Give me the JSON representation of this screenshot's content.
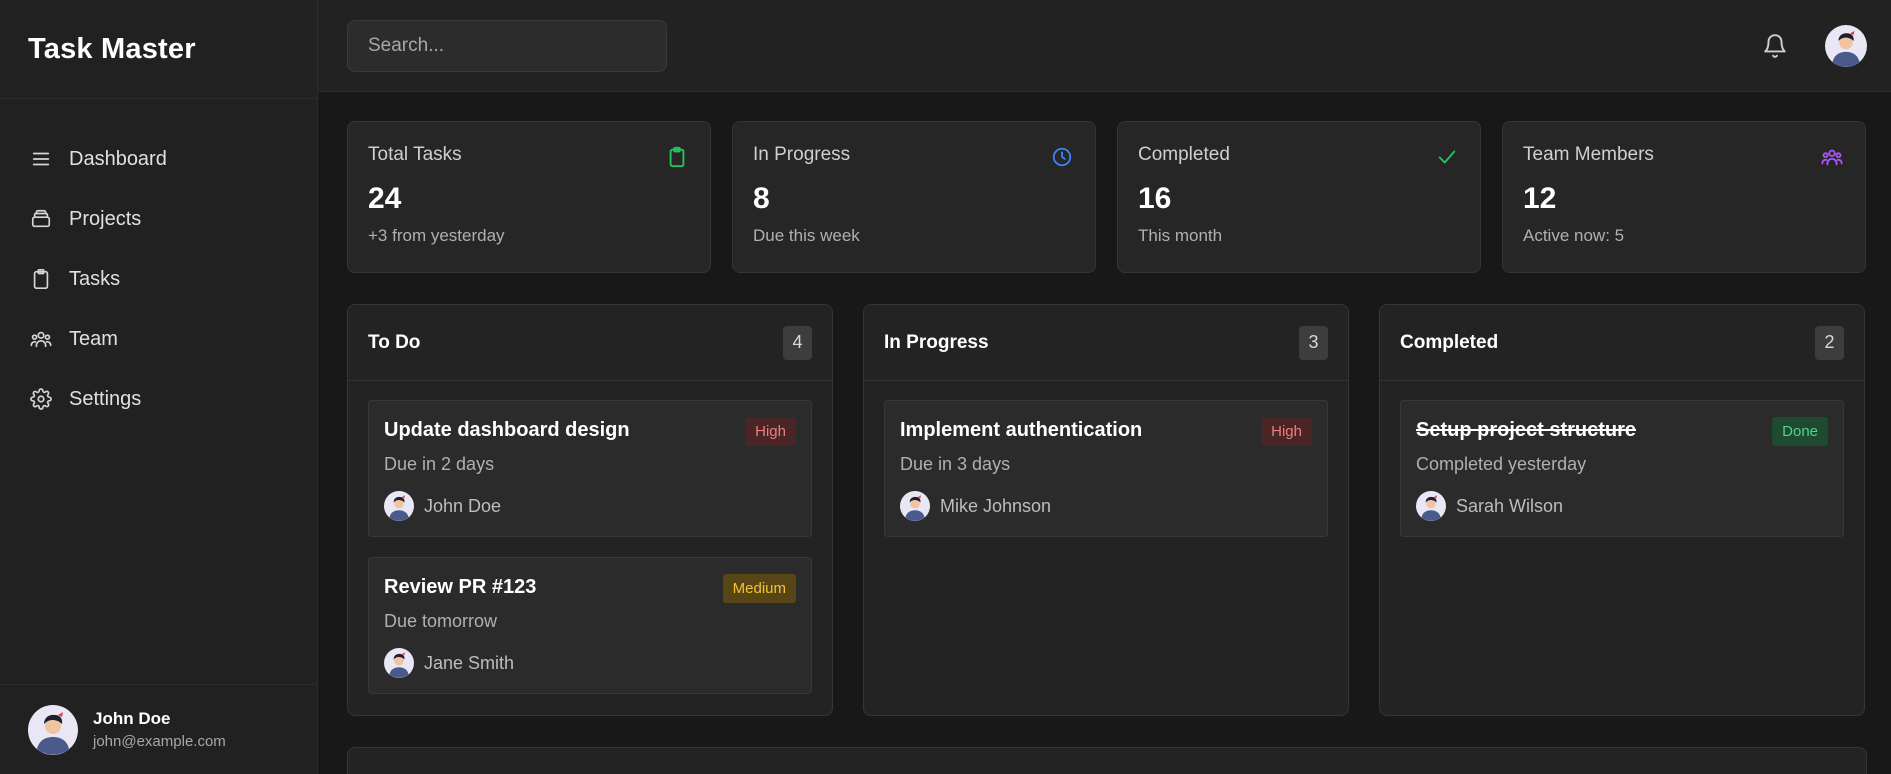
{
  "app": {
    "title": "Task Master"
  },
  "sidebar": {
    "items": [
      {
        "label": "Dashboard",
        "icon": "menu-icon"
      },
      {
        "label": "Projects",
        "icon": "layers-icon"
      },
      {
        "label": "Tasks",
        "icon": "clipboard-icon"
      },
      {
        "label": "Team",
        "icon": "users-icon"
      },
      {
        "label": "Settings",
        "icon": "gear-icon"
      }
    ],
    "user": {
      "name": "John Doe",
      "email": "john@example.com"
    }
  },
  "header": {
    "search_placeholder": "Search...",
    "search_value": ""
  },
  "stats": [
    {
      "label": "Total Tasks",
      "value": "24",
      "sub": "+3 from yesterday",
      "icon": "clipboard-icon",
      "color": "#22c55e"
    },
    {
      "label": "In Progress",
      "value": "8",
      "sub": "Due this week",
      "icon": "clock-icon",
      "color": "#3b82f6"
    },
    {
      "label": "Completed",
      "value": "16",
      "sub": "This month",
      "icon": "check-icon",
      "color": "#22c55e"
    },
    {
      "label": "Team Members",
      "value": "12",
      "sub": "Active now: 5",
      "icon": "users-icon",
      "color": "#a855f7"
    }
  ],
  "board": {
    "columns": [
      {
        "title": "To Do",
        "count": "4",
        "tasks": [
          {
            "title": "Update dashboard design",
            "due": "Due in 2 days",
            "assignee": "John Doe",
            "priority": "High",
            "priority_class": "high",
            "done": false
          },
          {
            "title": "Review PR #123",
            "due": "Due tomorrow",
            "assignee": "Jane Smith",
            "priority": "Medium",
            "priority_class": "medium",
            "done": false
          }
        ]
      },
      {
        "title": "In Progress",
        "count": "3",
        "tasks": [
          {
            "title": "Implement authentication",
            "due": "Due in 3 days",
            "assignee": "Mike Johnson",
            "priority": "High",
            "priority_class": "high",
            "done": false
          }
        ]
      },
      {
        "title": "Completed",
        "count": "2",
        "tasks": [
          {
            "title": "Setup project structure",
            "due": "Completed yesterday",
            "assignee": "Sarah Wilson",
            "priority": "Done",
            "priority_class": "done",
            "done": true
          }
        ]
      }
    ]
  }
}
